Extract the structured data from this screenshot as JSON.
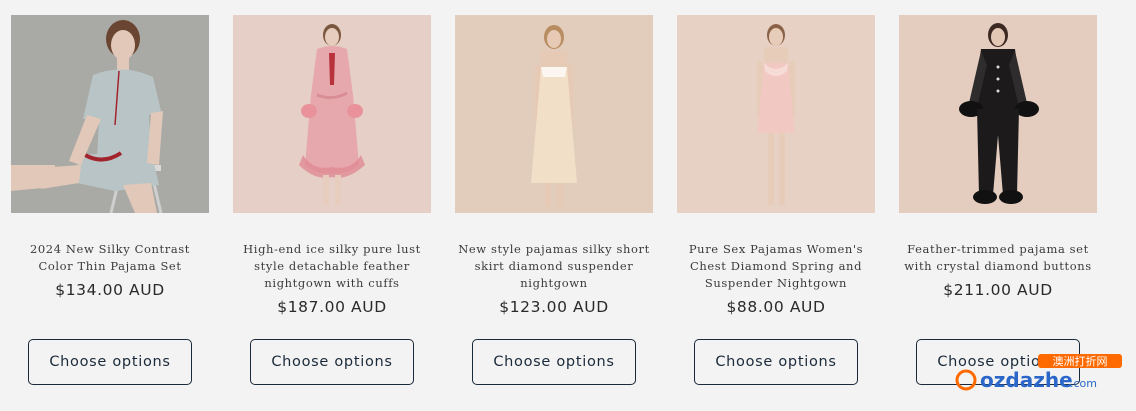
{
  "products": [
    {
      "title": "2024 New Silky Contrast Color Thin Pajama Set",
      "price": "$134.00 AUD",
      "button_label": "Choose options",
      "image_alt": "Model in silver-grey silk short pajama set with red piping, seated on a stool",
      "image_colors": {
        "bg": "#a9aaa6",
        "garment": "#b9c4c6",
        "accent": "#a3232c",
        "skin": "#e1c8b8",
        "hair": "#6a4632"
      }
    },
    {
      "title": "High-end ice silky pure lust style detachable feather nightgown with cuffs",
      "price": "$187.00 AUD",
      "button_label": "Choose options",
      "image_alt": "Model in pink silk robe with feather trim",
      "image_colors": {
        "bg": "#e6cfc7",
        "garment": "#e6a8ac",
        "accent": "#b8323c",
        "skin": "#e7cdbd",
        "hair": "#7b573f"
      }
    },
    {
      "title": "New style pajamas silky short skirt diamond suspender nightgown",
      "price": "$123.00 AUD",
      "button_label": "Choose options",
      "image_alt": "Model in champagne silk slip dress",
      "image_colors": {
        "bg": "#e2cdbc",
        "garment": "#f1dfc8",
        "accent": "#ffffff",
        "skin": "#e7cab6",
        "hair": "#b98d62"
      }
    },
    {
      "title": "Pure Sex Pajamas Women's Chest Diamond Spring and Suspender Nightgown",
      "price": "$88.00 AUD",
      "button_label": "Choose options",
      "image_alt": "Model in light pink silk mini slip dress",
      "image_colors": {
        "bg": "#e6d1c4",
        "garment": "#f2c8c2",
        "accent": "#f6dcd6",
        "skin": "#e7ccba",
        "hair": "#8a6248"
      }
    },
    {
      "title": "Feather-trimmed pajama set with crystal diamond buttons",
      "price": "$211.00 AUD",
      "button_label": "Choose options",
      "image_alt": "Model in black silk pajama set with feather cuffs",
      "image_colors": {
        "bg": "#e4cdbf",
        "garment": "#1c1a1b",
        "accent": "#2f2c2d",
        "skin": "#e3c7b5",
        "hair": "#3c2a22"
      }
    }
  ],
  "watermark": {
    "text_latin": "ozdazhe",
    "text_suffix": ".com",
    "text_cn": "澳洲打折网"
  }
}
